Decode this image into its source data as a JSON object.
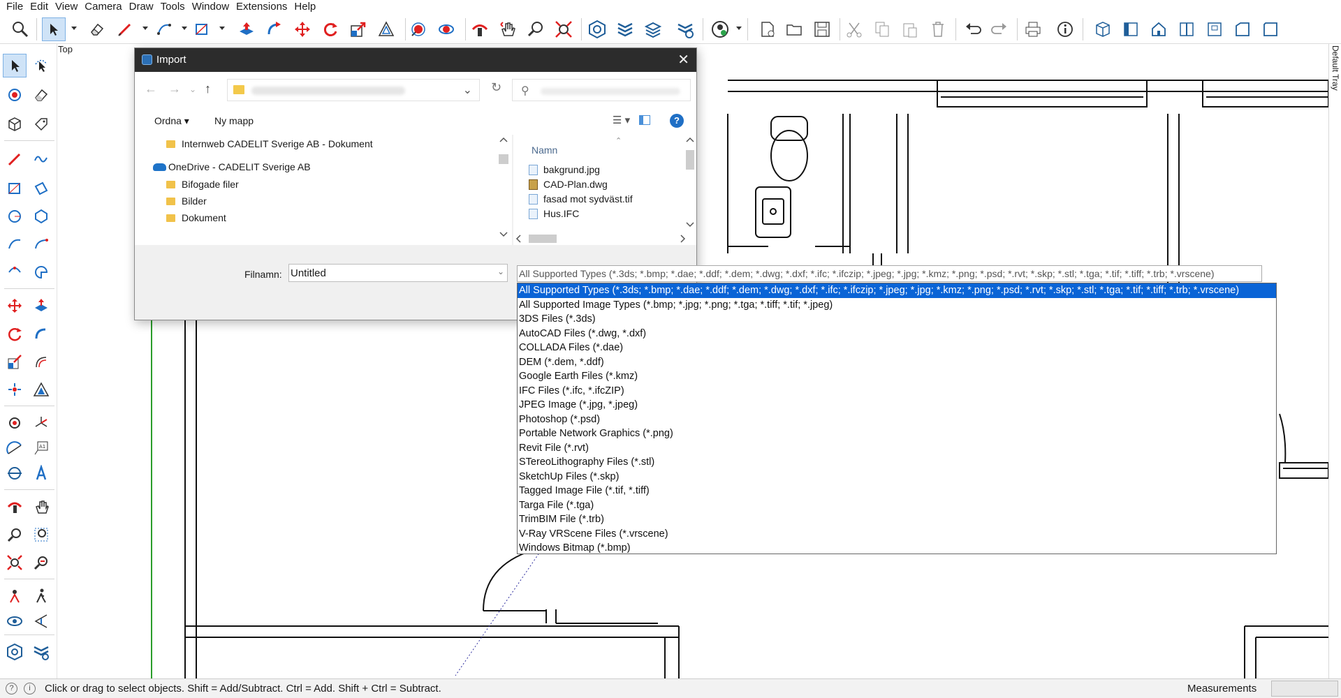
{
  "menu": [
    "File",
    "Edit",
    "View",
    "Camera",
    "Draw",
    "Tools",
    "Window",
    "Extensions",
    "Help"
  ],
  "viewport": {
    "scene_label": "Top",
    "tray_label": "Default Tray"
  },
  "status": {
    "text": "Click or drag to select objects. Shift = Add/Subtract. Ctrl = Add. Shift + Ctrl = Subtract.",
    "measurements_label": "Measurements",
    "measurements_value": ""
  },
  "dialog": {
    "title": "Import",
    "toolbar": {
      "organize": "Ordna",
      "new_folder": "Ny mapp"
    },
    "tree": [
      {
        "label": "Internweb CADELIT Sverige AB - Dokument",
        "icon": "folder-icon"
      },
      {
        "label": "OneDrive - CADELIT Sverige AB",
        "icon": "onedrive-icon"
      },
      {
        "label": "Bifogade filer",
        "icon": "folder-icon"
      },
      {
        "label": "Bilder",
        "icon": "folder-icon"
      },
      {
        "label": "Dokument",
        "icon": "folder-icon"
      }
    ],
    "files_header": "Namn",
    "files": [
      {
        "name": "bakgrund.jpg",
        "icon": "image-file-icon"
      },
      {
        "name": "CAD-Plan.dwg",
        "icon": "dwg-file-icon"
      },
      {
        "name": "fasad mot sydväst.tif",
        "icon": "image-file-icon"
      },
      {
        "name": "Hus.IFC",
        "icon": "ifc-file-icon"
      }
    ],
    "filename_label": "Filnamn:",
    "filename_value": "Untitled",
    "filetype_current": "All Supported Types (*.3ds; *.bmp; *.dae; *.ddf; *.dem; *.dwg; *.dxf; *.ifc; *.ifczip; *.jpeg; *.jpg; *.kmz; *.png; *.psd; *.rvt; *.skp; *.stl; *.tga; *.tif; *.tiff; *.trb; *.vrscene)",
    "filetype_options": [
      "All Supported Types (*.3ds; *.bmp; *.dae; *.ddf; *.dem; *.dwg; *.dxf; *.ifc; *.ifczip; *.jpeg; *.jpg; *.kmz; *.png; *.psd; *.rvt; *.skp; *.stl; *.tga; *.tif; *.tiff; *.trb; *.vrscene)",
      "All Supported Image Types (*.bmp; *.jpg; *.png; *.tga; *.tiff; *.tif; *.jpeg)",
      "3DS Files (*.3ds)",
      "AutoCAD Files (*.dwg, *.dxf)",
      "COLLADA Files (*.dae)",
      "DEM (*.dem, *.ddf)",
      "Google Earth Files (*.kmz)",
      "IFC Files (*.ifc, *.ifcZIP)",
      "JPEG Image (*.jpg, *.jpeg)",
      "Photoshop (*.psd)",
      "Portable Network Graphics (*.png)",
      "Revit File (*.rvt)",
      "STereoLithography Files (*.stl)",
      "SketchUp Files (*.skp)",
      "Tagged Image File (*.tif, *.tiff)",
      "Targa File (*.tga)",
      "TrimBIM File (*.trb)",
      "V-Ray VRScene Files  (*.vrscene)",
      "Windows Bitmap (*.bmp)"
    ],
    "filetype_selected_index": 0
  },
  "colors": {
    "accent": "#0a64d6",
    "tool_red": "#e02020",
    "tool_blue": "#1f6fc5",
    "title_bar": "#2c2c2c"
  }
}
